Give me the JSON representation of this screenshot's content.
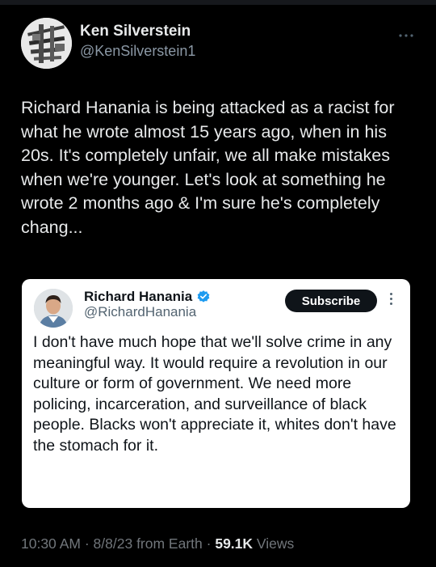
{
  "tweet": {
    "author": {
      "display_name": "Ken Silverstein",
      "handle": "@KenSilverstein1"
    },
    "more_icon": "ellipsis-icon",
    "text": "Richard Hanania is being attacked as a racist for what he wrote almost 15 years ago, when in his 20s. It's completely unfair, we all make mistakes when we're younger. Let's look at something he wrote 2 months ago & I'm sure he's completely chang...",
    "quoted": {
      "display_name": "Richard Hanania",
      "handle": "@RichardHanania",
      "verified_icon": "verified-badge-icon",
      "subscribe_label": "Subscribe",
      "text": "I don't have much hope that we'll solve crime in any meaningful way. It would require a revolution in our culture or form of government. We need more policing, incarceration, and surveillance of black people. Blacks won't appreciate it, whites don't have the stomach for it."
    },
    "meta": {
      "time": "10:30 AM",
      "date": "8/8/23",
      "source": "from Earth",
      "views_count": "59.1K",
      "views_label": "Views"
    },
    "colors": {
      "background": "#000000",
      "text": "#e7e9ea",
      "secondary": "#71767b",
      "verified": "#1d9bf0",
      "card": "#ffffff"
    }
  }
}
